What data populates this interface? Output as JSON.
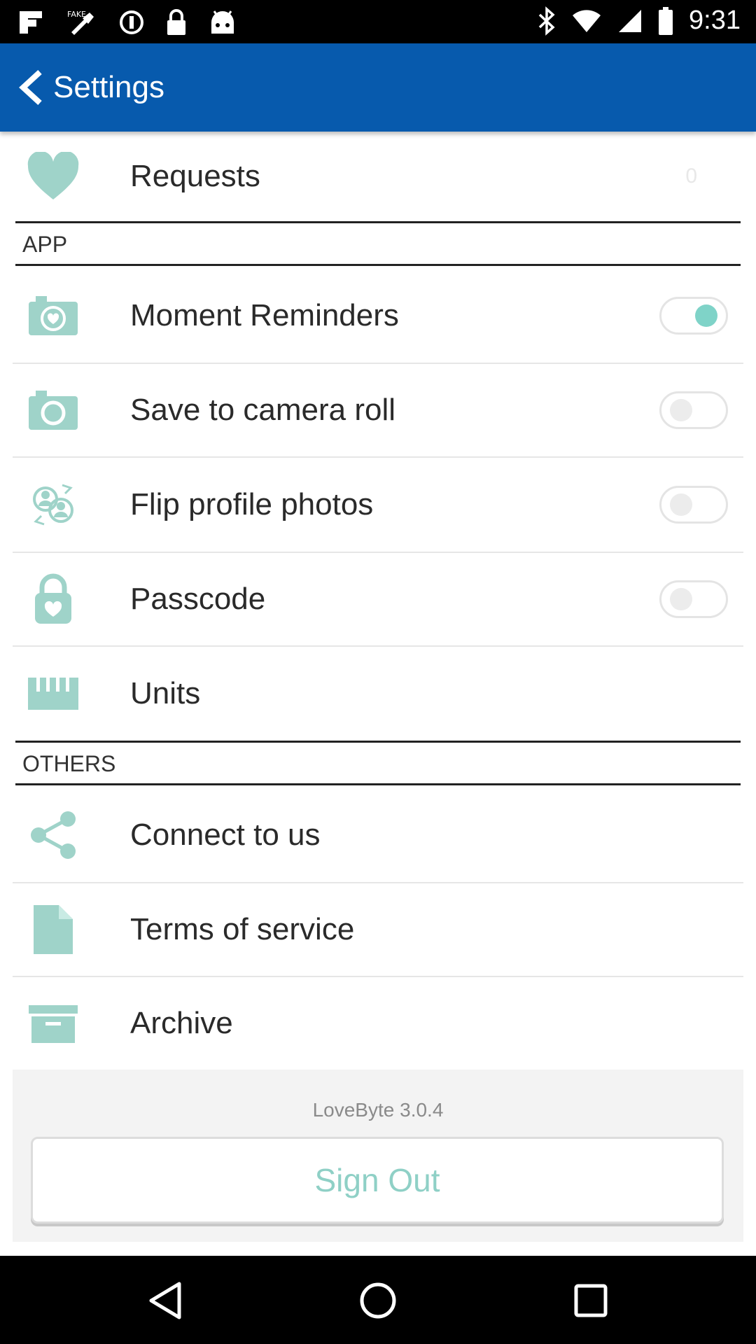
{
  "status_bar": {
    "time": "9:31",
    "left_icons": [
      "flipboard-icon",
      "fake-gps-icon",
      "circle-status-icon",
      "lock-icon",
      "android-icon"
    ],
    "right_icons": [
      "bluetooth-icon",
      "wifi-icon",
      "cellular-icon",
      "battery-icon"
    ]
  },
  "app_bar": {
    "title": "Settings",
    "color": "#075aad"
  },
  "requests": {
    "label": "Requests",
    "count": "0"
  },
  "sections": {
    "app": {
      "title": "APP"
    },
    "others": {
      "title": "OTHERS"
    }
  },
  "app_items": [
    {
      "label": "Moment Reminders",
      "icon": "camera-heart-icon",
      "toggle": true
    },
    {
      "label": "Save to camera roll",
      "icon": "camera-icon",
      "toggle": false
    },
    {
      "label": "Flip profile photos",
      "icon": "flip-profiles-icon",
      "toggle": false
    },
    {
      "label": "Passcode",
      "icon": "lock-heart-icon",
      "toggle": false
    },
    {
      "label": "Units",
      "icon": "ruler-icon"
    }
  ],
  "other_items": [
    {
      "label": "Connect to us",
      "icon": "share-icon"
    },
    {
      "label": "Terms of service",
      "icon": "document-icon"
    },
    {
      "label": "Archive",
      "icon": "archive-box-icon"
    }
  ],
  "footer": {
    "version": "LoveByte 3.0.4",
    "sign_out_label": "Sign Out"
  },
  "colors": {
    "icon": "#9fd3c9",
    "toggle_on": "#7fd3c8",
    "accent": "#075aad"
  },
  "nav_bar": {
    "buttons": [
      "back-icon",
      "home-icon",
      "recents-icon"
    ]
  }
}
